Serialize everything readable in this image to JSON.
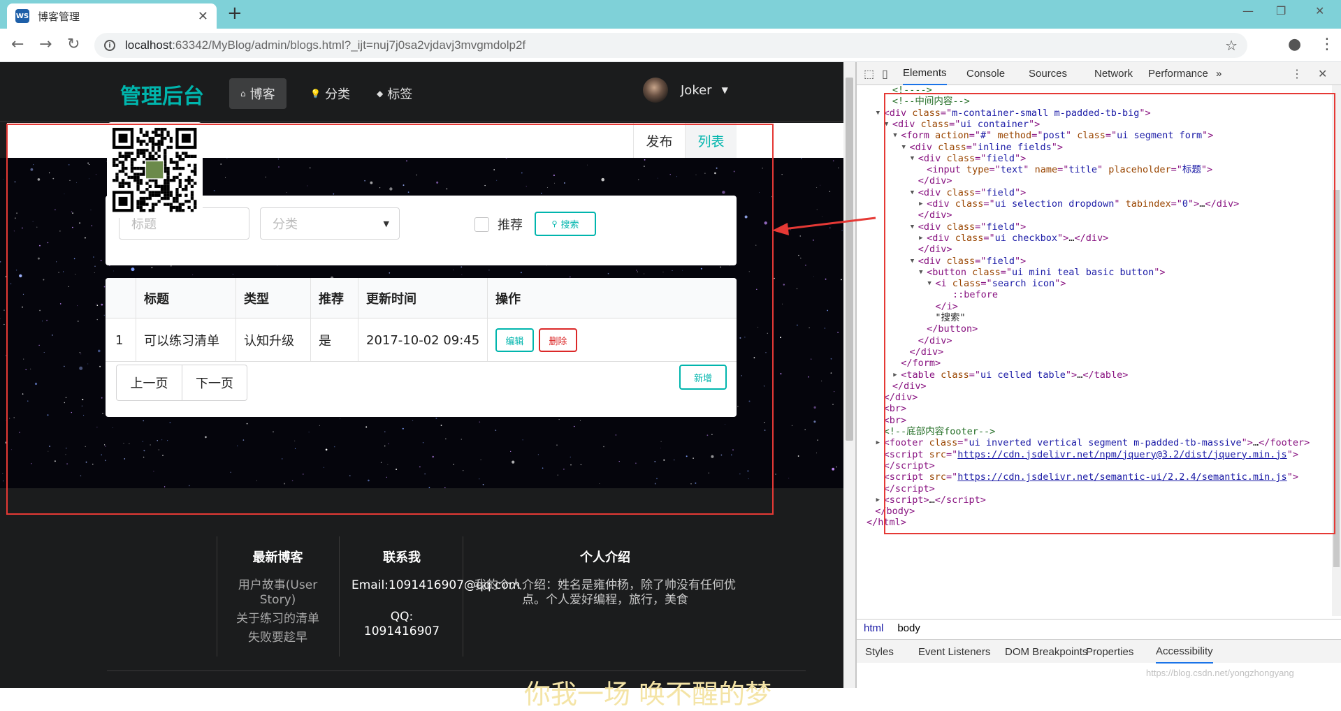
{
  "browser": {
    "tab_title": "博客管理",
    "tab_favicon": "WS",
    "url_host": "localhost",
    "url_rest": ":63342/MyBlog/admin/blogs.html?_ijt=nuj7j0sa2vjdavj3mvgmdolp2f"
  },
  "nav": {
    "brand": "管理后台",
    "items": [
      {
        "label": "博客",
        "icon": "home-icon",
        "glyph": "⌂"
      },
      {
        "label": "分类",
        "icon": "idea-icon",
        "glyph": "💡"
      },
      {
        "label": "标签",
        "icon": "tags-icon",
        "glyph": "◆"
      }
    ],
    "user": "Joker"
  },
  "submenu": {
    "publish": "发布",
    "list": "列表"
  },
  "search": {
    "title_placeholder": "标题",
    "category_placeholder": "分类",
    "recommend_label": "推荐",
    "search_button": "搜索"
  },
  "table": {
    "headers": [
      "",
      "标题",
      "类型",
      "推荐",
      "更新时间",
      "操作"
    ],
    "rows": [
      {
        "index": "1",
        "title": "可以练习清单",
        "type": "认知升级",
        "recommend": "是",
        "updated": "2017-10-02 09:45",
        "edit": "编辑",
        "delete": "删除"
      }
    ],
    "prev": "上一页",
    "next": "下一页",
    "add": "新增"
  },
  "footer": {
    "latest_title": "最新博客",
    "latest_items": [
      "用户故事(User Story)",
      "关于练习的清单",
      "失败要趁早"
    ],
    "contact_title": "联系我",
    "email": "Email:1091416907@qq.com",
    "qq_label": "QQ:",
    "qq": "1091416907",
    "about_title": "个人介绍",
    "about_text": "我的个人介绍：姓名是雍仲杨，除了帅没有任何优点。个人爱好编程，旅行，美食",
    "banner": "你我一场 唤不醒的梦"
  },
  "devtools": {
    "tabs": [
      "Elements",
      "Console",
      "Sources",
      "Network",
      "Performance"
    ],
    "more": "»",
    "dom_lines": [
      {
        "indent": 3,
        "html": "<span class='cm'>&lt;!----&gt;</span>"
      },
      {
        "indent": 3,
        "html": "<span class='cm'>&lt;!--中间内容--&gt;</span>"
      },
      {
        "indent": 2,
        "arrow": "▼",
        "html": "<span class='tag'>&lt;div </span><span class='att'>class</span><span class='tag'>=\"</span><span class='val'>m-container-small m-padded-tb-big</span><span class='tag'>\"&gt;</span>"
      },
      {
        "indent": 3,
        "arrow": "▼",
        "html": "<span class='tag'>&lt;div </span><span class='att'>class</span><span class='tag'>=\"</span><span class='val'>ui container</span><span class='tag'>\"&gt;</span>"
      },
      {
        "indent": 4,
        "arrow": "▼",
        "html": "<span class='tag'>&lt;form </span><span class='att'>action</span><span class='tag'>=\"</span><span class='val'>#</span><span class='tag'>\" </span><span class='att'>method</span><span class='tag'>=\"</span><span class='val'>post</span><span class='tag'>\" </span><span class='att'>class</span><span class='tag'>=\"</span><span class='val'>ui segment form</span><span class='tag'>\"&gt;</span>"
      },
      {
        "indent": 5,
        "arrow": "▼",
        "html": "<span class='tag'>&lt;div </span><span class='att'>class</span><span class='tag'>=\"</span><span class='val'>inline fields</span><span class='tag'>\"&gt;</span>"
      },
      {
        "indent": 6,
        "arrow": "▼",
        "html": "<span class='tag'>&lt;div </span><span class='att'>class</span><span class='tag'>=\"</span><span class='val'>field</span><span class='tag'>\"&gt;</span>"
      },
      {
        "indent": 7,
        "html": "<span class='tag'>&lt;input </span><span class='att'>type</span><span class='tag'>=\"</span><span class='val'>text</span><span class='tag'>\" </span><span class='att'>name</span><span class='tag'>=\"</span><span class='val'>title</span><span class='tag'>\" </span><span class='att'>placeholder</span><span class='tag'>=\"</span><span class='val'>标题</span><span class='tag'>\"&gt;</span>"
      },
      {
        "indent": 6,
        "html": "<span class='tag'>&lt;/div&gt;</span>"
      },
      {
        "indent": 6,
        "arrow": "▼",
        "html": "<span class='tag'>&lt;div </span><span class='att'>class</span><span class='tag'>=\"</span><span class='val'>field</span><span class='tag'>\"&gt;</span>"
      },
      {
        "indent": 7,
        "arrow": "▶",
        "html": "<span class='tag'>&lt;div </span><span class='att'>class</span><span class='tag'>=\"</span><span class='val'>ui selection dropdown</span><span class='tag'>\" </span><span class='att'>tabindex</span><span class='tag'>=\"</span><span class='val'>0</span><span class='tag'>\"&gt;</span><span class='tx'>…</span><span class='tag'>&lt;/div&gt;</span>"
      },
      {
        "indent": 6,
        "html": "<span class='tag'>&lt;/div&gt;</span>"
      },
      {
        "indent": 6,
        "arrow": "▼",
        "html": "<span class='tag'>&lt;div </span><span class='att'>class</span><span class='tag'>=\"</span><span class='val'>field</span><span class='tag'>\"&gt;</span>"
      },
      {
        "indent": 7,
        "arrow": "▶",
        "html": "<span class='tag'>&lt;div </span><span class='att'>class</span><span class='tag'>=\"</span><span class='val'>ui checkbox</span><span class='tag'>\"&gt;</span><span class='tx'>…</span><span class='tag'>&lt;/div&gt;</span>"
      },
      {
        "indent": 6,
        "html": "<span class='tag'>&lt;/div&gt;</span>"
      },
      {
        "indent": 6,
        "arrow": "▼",
        "html": "<span class='tag'>&lt;div </span><span class='att'>class</span><span class='tag'>=\"</span><span class='val'>field</span><span class='tag'>\"&gt;</span>"
      },
      {
        "indent": 7,
        "arrow": "▼",
        "html": "<span class='tag'>&lt;button </span><span class='att'>class</span><span class='tag'>=\"</span><span class='val'>ui mini teal basic button</span><span class='tag'>\"&gt;</span>"
      },
      {
        "indent": 8,
        "arrow": "▼",
        "html": "<span class='tag'>&lt;i </span><span class='att'>class</span><span class='tag'>=\"</span><span class='val'>search icon</span><span class='tag'>\"&gt;</span>"
      },
      {
        "indent": 10,
        "html": "<span class='tag'>::before</span>"
      },
      {
        "indent": 8,
        "html": "<span class='tag'>&lt;/i&gt;</span>"
      },
      {
        "indent": 8,
        "html": "<span class='tx'>\"搜索\"</span>"
      },
      {
        "indent": 7,
        "html": "<span class='tag'>&lt;/button&gt;</span>"
      },
      {
        "indent": 6,
        "html": "<span class='tag'>&lt;/div&gt;</span>"
      },
      {
        "indent": 5,
        "html": "<span class='tag'>&lt;/div&gt;</span>"
      },
      {
        "indent": 4,
        "html": "<span class='tag'>&lt;/form&gt;</span>"
      },
      {
        "indent": 4,
        "arrow": "▶",
        "html": "<span class='tag'>&lt;table </span><span class='att'>class</span><span class='tag'>=\"</span><span class='val'>ui celled table</span><span class='tag'>\"&gt;</span><span class='tx'>…</span><span class='tag'>&lt;/table&gt;</span>"
      },
      {
        "indent": 3,
        "html": "<span class='tag'>&lt;/div&gt;</span>"
      },
      {
        "indent": 2,
        "html": "<span class='tag'>&lt;/div&gt;</span>"
      },
      {
        "indent": 2,
        "html": "<span class='tag'>&lt;br&gt;</span>"
      },
      {
        "indent": 2,
        "html": "<span class='tag'>&lt;br&gt;</span>"
      },
      {
        "indent": 2,
        "html": "<span class='cm'>&lt;!--底部内容footer--&gt;</span>"
      },
      {
        "indent": 2,
        "arrow": "▶",
        "html": "<span class='tag'>&lt;footer </span><span class='att'>class</span><span class='tag'>=\"</span><span class='val'>ui inverted vertical segment m-padded-tb-massive</span><span class='tag'>\"&gt;</span><span class='tx'>…</span><span class='tag'>&lt;/footer&gt;</span>"
      },
      {
        "indent": 2,
        "html": "<span class='tag'>&lt;script </span><span class='att'>src</span><span class='tag'>=\"</span><span class='lnk'>https://cdn.jsdelivr.net/npm/jquery@3.2/dist/jquery.min.js</span><span class='tag'>\"&gt;</span>"
      },
      {
        "indent": 2,
        "html": "<span class='tag'>&lt;/script&gt;</span>"
      },
      {
        "indent": 2,
        "html": "<span class='tag'>&lt;script </span><span class='att'>src</span><span class='tag'>=\"</span><span class='lnk'>https://cdn.jsdelivr.net/semantic-ui/2.2.4/semantic.min.js</span><span class='tag'>\"&gt;</span>"
      },
      {
        "indent": 2,
        "html": "<span class='tag'>&lt;/script&gt;</span>"
      },
      {
        "indent": 2,
        "arrow": "▶",
        "html": "<span class='tag'>&lt;script&gt;</span><span class='tx'>…</span><span class='tag'>&lt;/script&gt;</span>"
      },
      {
        "indent": 1,
        "html": "<span class='tag'>&lt;/body&gt;</span>"
      },
      {
        "indent": 0,
        "html": "<span class='tag'>&lt;/html&gt;</span>"
      }
    ],
    "breadcrumbs": [
      "html",
      "body"
    ],
    "subtabs": [
      "Styles",
      "Event Listeners",
      "DOM Breakpoints",
      "Properties",
      "Accessibility"
    ],
    "watermark": "https://blog.csdn.net/yongzhongyang"
  }
}
